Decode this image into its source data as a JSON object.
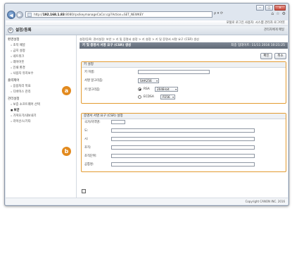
{
  "browser": {
    "url_prefix": "http://",
    "url_host": "192.168.1.83",
    "url_rest": ":8080/rps/keymanageCaCsr.cgi?Action=SET_NEWKEY",
    "tools": "ρ ▾ ⟳",
    "window_buttons": [
      "−",
      "□",
      "✕"
    ]
  },
  "topbar": {
    "text": "로그인 사용자: 시스템 관리자 로그아웃",
    "prefix": "포털로"
  },
  "header": {
    "title": "설정/등록",
    "link": "관리자에게 메일"
  },
  "sidebar": {
    "sections": [
      {
        "title": "환경설정",
        "items": [
          "조작 패널",
          "급지 설정",
          "네트워크",
          "레이아웃",
          "인쇄 환경",
          "사용자 유지보수"
        ]
      },
      {
        "title": "출력제어",
        "items": [
          "응용처리 목표",
          "디바이스 관리"
        ]
      },
      {
        "title": "관리설정",
        "items": [
          "보증 소프트웨어 선택",
          "보안",
          "가져오기/내보내기",
          "라이선스/기타"
        ]
      }
    ],
    "active_item": "보안"
  },
  "main": {
    "breadcrumb": "설정/등록: 관리설정: 보안 > 키 및 증명서 설정 > 키 설정 > 키 및 증명서 서명 요구 (CSR) 생성",
    "bar_title": "키 및 증명서 서명 요구 (CSR) 생성",
    "bar_date": "최종 업데이트: 11/11 2016 10:21:25",
    "buttons": {
      "ok": "확인",
      "cancel": "취소"
    },
    "key_panel": {
      "title": "키 설정",
      "key_name_label": "키 이름:",
      "key_name_value": "",
      "sig_label": "서명 알고리즘:",
      "sig_value": "SHA256",
      "key_alg_label": "키 알고리즘:",
      "rsa_label": "RSA",
      "rsa_value": "2048-bit",
      "ecdsa_label": "ECDSA",
      "ecdsa_value": "P256"
    },
    "csr_panel": {
      "title": "증명서 서명 요구 (CSR) 설정",
      "fields": [
        {
          "label": "국가/지역명:",
          "value": ""
        },
        {
          "label": "도:",
          "value": ""
        },
        {
          "label": "시:",
          "value": ""
        },
        {
          "label": "조직:",
          "value": ""
        },
        {
          "label": "조직단위:",
          "value": ""
        },
        {
          "label": "공통명:",
          "value": ""
        }
      ]
    }
  },
  "footer": {
    "copyright": "Copyright CANON INC. 2016"
  },
  "callouts": {
    "a": "a",
    "b": "b"
  },
  "colors": {
    "accent": "#e39b31",
    "callout": "#e28a1e",
    "header_bar": "#6b7480"
  }
}
